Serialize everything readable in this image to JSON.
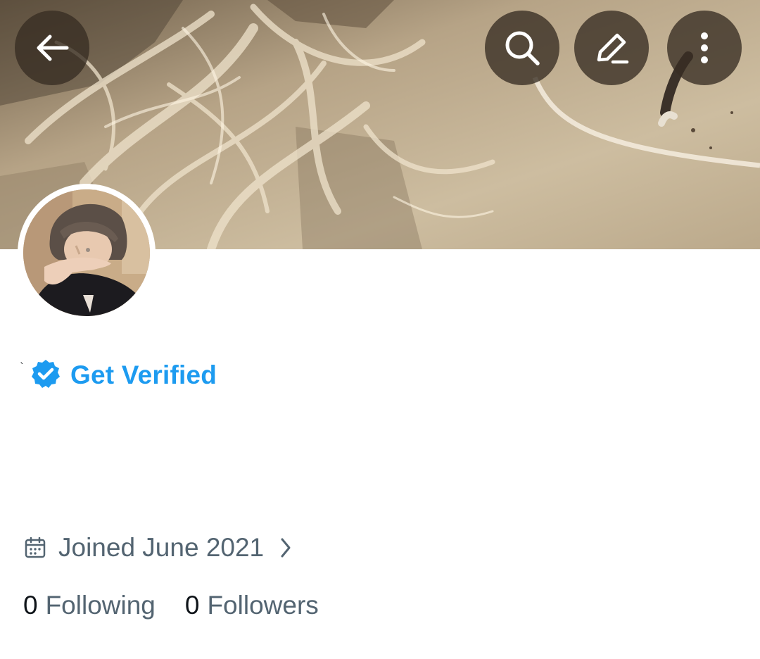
{
  "header": {
    "back_icon": "arrow-left-icon",
    "search_icon": "search-icon",
    "edit_icon": "pencil-icon",
    "more_icon": "more-vertical-icon"
  },
  "profile": {
    "display_name": "`",
    "verify_badge_icon": "verified-badge-icon",
    "get_verified_label": "Get Verified",
    "joined_icon": "calendar-icon",
    "joined_text": "Joined June 2021",
    "joined_chevron_icon": "chevron-right-icon",
    "following_count": "0",
    "following_label": "Following",
    "followers_count": "0",
    "followers_label": "Followers"
  },
  "colors": {
    "accent": "#1d9bf0",
    "text_primary": "#0f1419",
    "text_secondary": "#536471",
    "overlay_button": "#372d23"
  }
}
